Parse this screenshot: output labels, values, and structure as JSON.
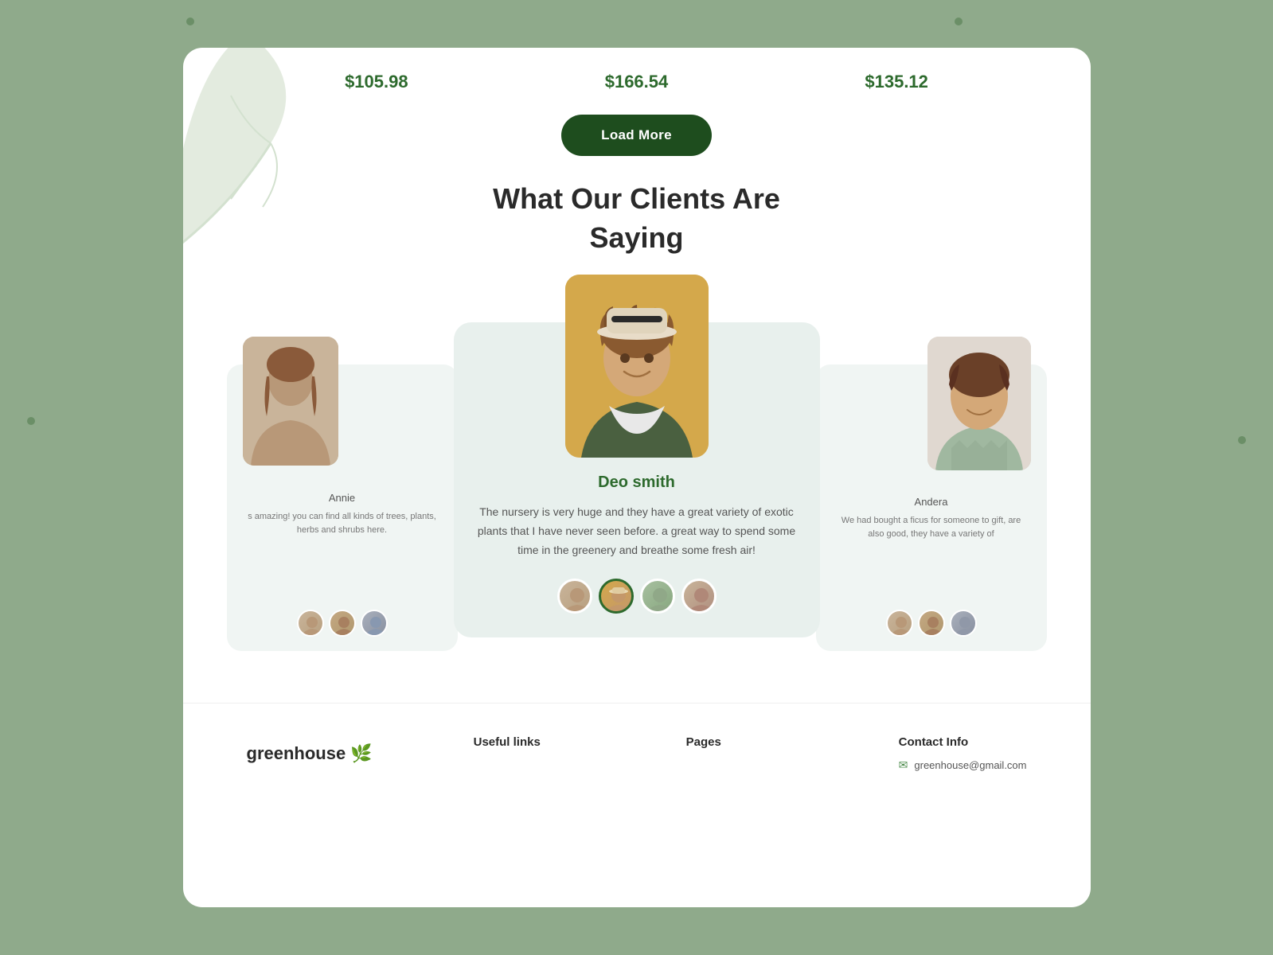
{
  "background": {
    "color": "#8faa8b"
  },
  "prices": {
    "price1": "$105.98",
    "price2": "$166.54",
    "price3": "$135.12"
  },
  "load_more_button": {
    "label": "Load More"
  },
  "testimonials_section": {
    "title_line1": "What Our Clients Are",
    "title_line2": "Saying",
    "center_reviewer": {
      "name": "Deo smith",
      "review": "The nursery is very huge and they have a great variety of exotic plants that I have never seen before.  a great way to spend some time in the greenery and breathe some fresh air!"
    },
    "left_reviewer": {
      "name": "Annie",
      "review": "s amazing! you can find all kinds of trees, plants, herbs and shrubs here."
    },
    "right_reviewer": {
      "name": "Andera",
      "review": "We had bought a ficus for someone to gift, are also good, they have a variety of"
    }
  },
  "footer": {
    "logo_text": "greenhouse",
    "logo_leaf": "🌿",
    "useful_links_heading": "Useful links",
    "pages_heading": "Pages",
    "contact_heading": "Contact Info",
    "contact_email": "greenhouse@gmail.com"
  }
}
